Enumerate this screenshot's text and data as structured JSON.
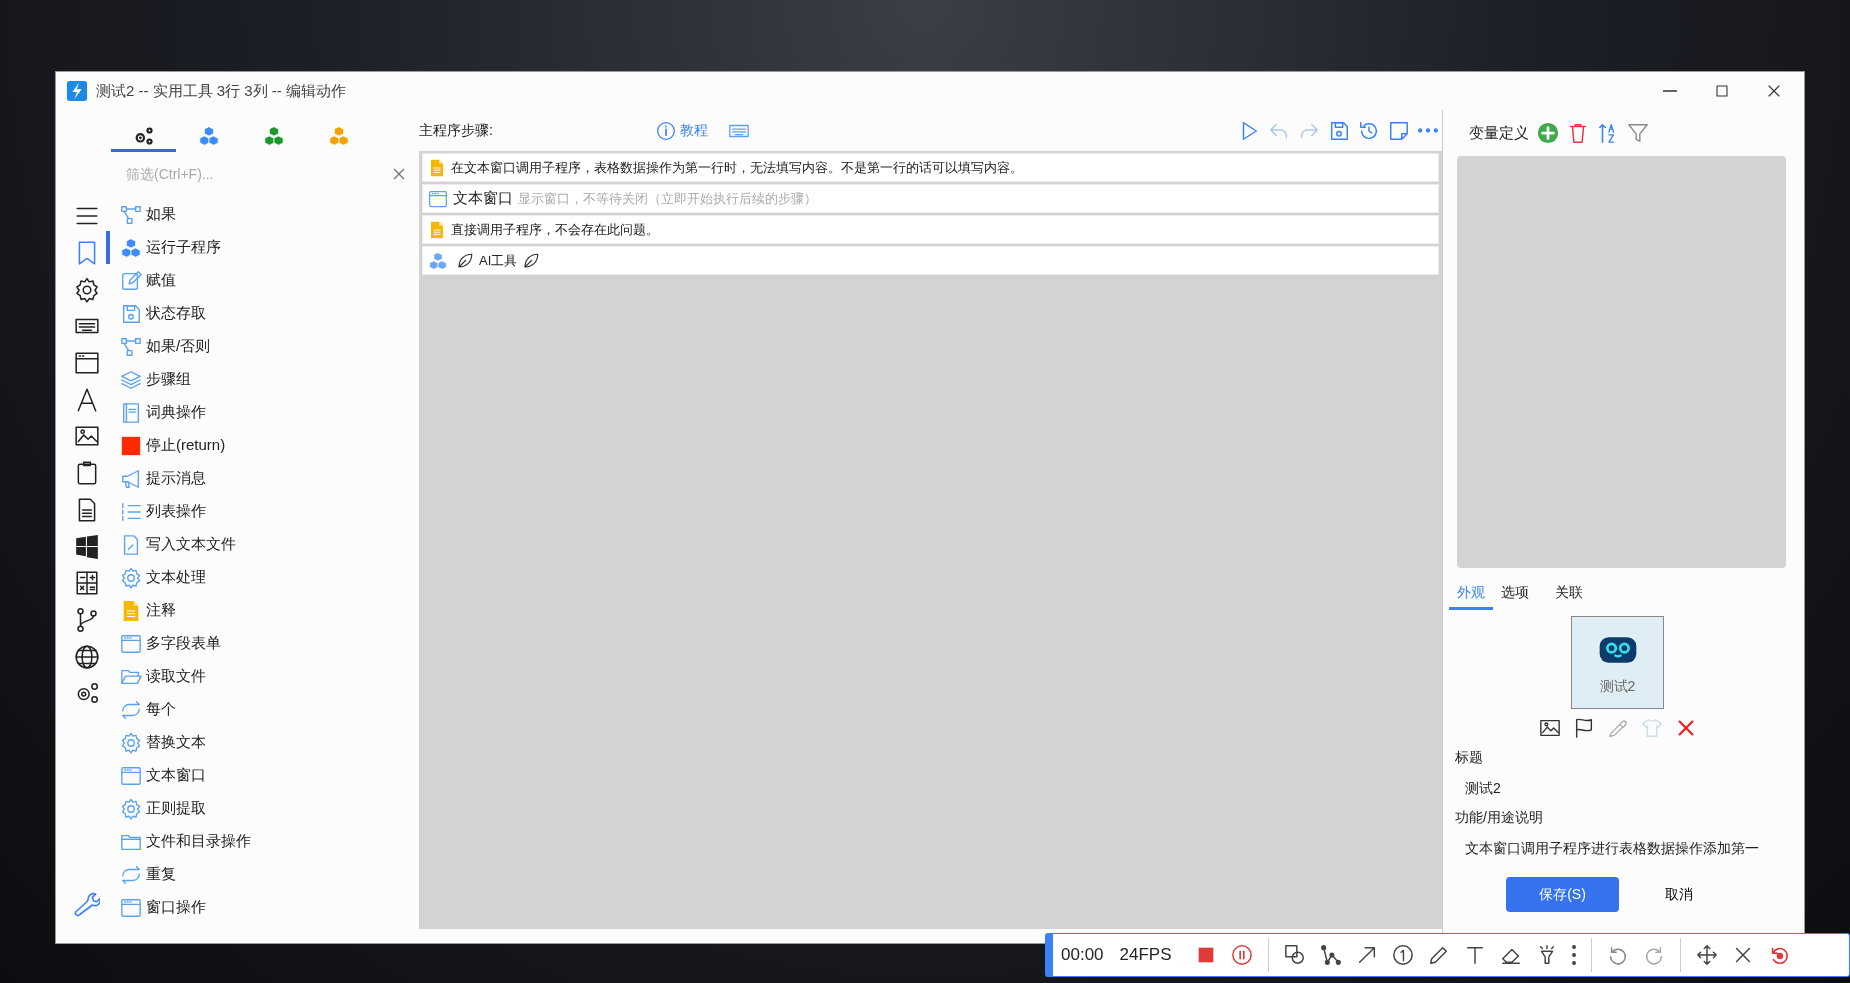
{
  "window": {
    "title": "测试2 -- 实用工具 3行 3列 -- 编辑动作"
  },
  "category_tabs": [
    {
      "kind": "gears",
      "color": "#222222",
      "selected": true
    },
    {
      "kind": "cubes",
      "color": "#3d8bfd",
      "selected": false
    },
    {
      "kind": "cubes",
      "color": "#1a9a2a",
      "selected": false
    },
    {
      "kind": "cubes",
      "color": "#f5a000",
      "selected": false
    }
  ],
  "filter": {
    "placeholder": "筛选(Ctrl+F)..."
  },
  "actions": [
    {
      "kind": "branch",
      "label": "如果",
      "selected": false
    },
    {
      "kind": "cubes",
      "label": "运行子程序",
      "selected": true
    },
    {
      "kind": "edit",
      "label": "赋值",
      "selected": false
    },
    {
      "kind": "save",
      "label": "状态存取",
      "selected": false
    },
    {
      "kind": "branch",
      "label": "如果/否则",
      "selected": false
    },
    {
      "kind": "layers",
      "label": "步骤组",
      "selected": false
    },
    {
      "kind": "book",
      "label": "词典操作",
      "selected": false
    },
    {
      "kind": "stop",
      "label": "停止(return)",
      "selected": false
    },
    {
      "kind": "megaphone",
      "label": "提示消息",
      "selected": false
    },
    {
      "kind": "list",
      "label": "列表操作",
      "selected": false
    },
    {
      "kind": "fileedit",
      "label": "写入文本文件",
      "selected": false
    },
    {
      "kind": "gear",
      "label": "文本处理",
      "selected": false
    },
    {
      "kind": "note",
      "label": "注释",
      "selected": false
    },
    {
      "kind": "window",
      "label": "多字段表单",
      "selected": false
    },
    {
      "kind": "folderopen",
      "label": "读取文件",
      "selected": false
    },
    {
      "kind": "loop",
      "label": "每个",
      "selected": false
    },
    {
      "kind": "gear",
      "label": "替换文本",
      "selected": false
    },
    {
      "kind": "window",
      "label": "文本窗口",
      "selected": false
    },
    {
      "kind": "gear",
      "label": "正则提取",
      "selected": false
    },
    {
      "kind": "folder",
      "label": "文件和目录操作",
      "selected": false
    },
    {
      "kind": "loop",
      "label": "重复",
      "selected": false
    },
    {
      "kind": "window",
      "label": "窗口操作",
      "selected": false
    }
  ],
  "steps": {
    "title": "主程序步骤:",
    "tutorial_link": "教程",
    "rows": [
      {
        "kind": "note",
        "text": "在文本窗口调用子程序，表格数据操作为第一行时，无法填写内容。不是第一行的话可以填写内容。"
      },
      {
        "kind": "window",
        "text": "文本窗口",
        "hint": "显示窗口，不等待关闭（立即开始执行后续的步骤）"
      },
      {
        "kind": "note",
        "text": "直接调用子程序，不会存在此问题。"
      },
      {
        "kind": "subprogram",
        "text": "AI工具"
      }
    ]
  },
  "variables": {
    "title": "变量定义"
  },
  "tabs": [
    {
      "label": "外观",
      "selected": true
    },
    {
      "label": "选项",
      "selected": false
    },
    {
      "label": "关联",
      "selected": false
    }
  ],
  "preview": {
    "caption": "测试2"
  },
  "fields": [
    {
      "label": "标题",
      "value": "测试2"
    },
    {
      "label": "功能/用途说明",
      "value": "文本窗口调用子程序进行表格数据操作添加第一"
    }
  ],
  "buttons": {
    "save": "保存(S)",
    "cancel": "取消"
  },
  "recorder": {
    "time": "00:00",
    "fps": "24FPS"
  }
}
